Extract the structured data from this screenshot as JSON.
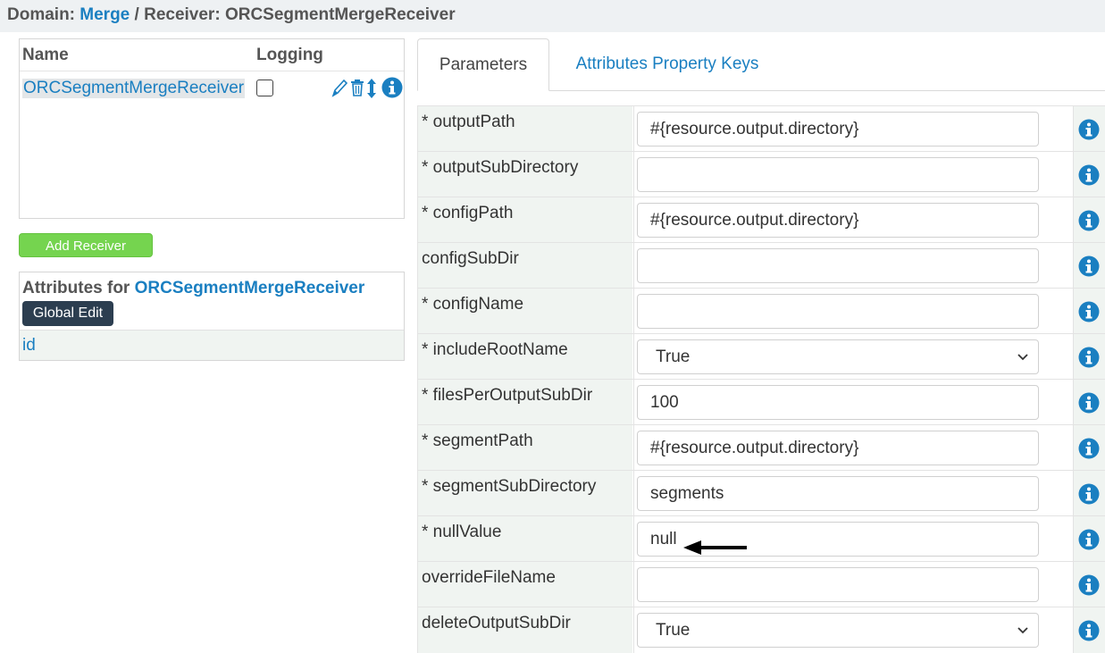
{
  "breadcrumb": {
    "domain_label": "Domain:",
    "domain_value": "Merge",
    "separator": " / ",
    "receiver_label": "Receiver:",
    "receiver_value": "ORCSegmentMergeReceiver"
  },
  "receivers": {
    "col_name": "Name",
    "col_logging": "Logging",
    "row": {
      "name": "ORCSegmentMergeReceiver",
      "logging": false
    },
    "icons": [
      "pencil-icon",
      "trash-icon",
      "move-updown-icon",
      "info-icon"
    ]
  },
  "add_receiver_label": "Add Receiver",
  "attributes": {
    "title_prefix": "Attributes for",
    "title_name": "ORCSegmentMergeReceiver",
    "global_edit_label": "Global Edit",
    "items": [
      "id"
    ]
  },
  "tabs": [
    {
      "label": "Parameters",
      "active": true
    },
    {
      "label": "Attributes Property Keys",
      "active": false
    }
  ],
  "parameters": [
    {
      "name": "* outputPath",
      "type": "text",
      "value": "#{resource.output.directory}"
    },
    {
      "name": "* outputSubDirectory",
      "type": "text",
      "value": ""
    },
    {
      "name": "* configPath",
      "type": "text",
      "value": "#{resource.output.directory}"
    },
    {
      "name": "configSubDir",
      "type": "text",
      "value": ""
    },
    {
      "name": "* configName",
      "type": "text",
      "value": ""
    },
    {
      "name": "* includeRootName",
      "type": "select",
      "value": "True"
    },
    {
      "name": "* filesPerOutputSubDir",
      "type": "text",
      "value": "100"
    },
    {
      "name": "* segmentPath",
      "type": "text",
      "value": "#{resource.output.directory}"
    },
    {
      "name": "* segmentSubDirectory",
      "type": "text",
      "value": "segments"
    },
    {
      "name": "* nullValue",
      "type": "text",
      "value": "null"
    },
    {
      "name": "overrideFileName",
      "type": "text",
      "value": ""
    },
    {
      "name": "deleteOutputSubDir",
      "type": "select",
      "value": "True"
    }
  ],
  "colors": {
    "link": "#1a7fc1",
    "add_button": "#75d44f",
    "global_button": "#2c3e50",
    "row_shade": "#f0f4f1"
  }
}
